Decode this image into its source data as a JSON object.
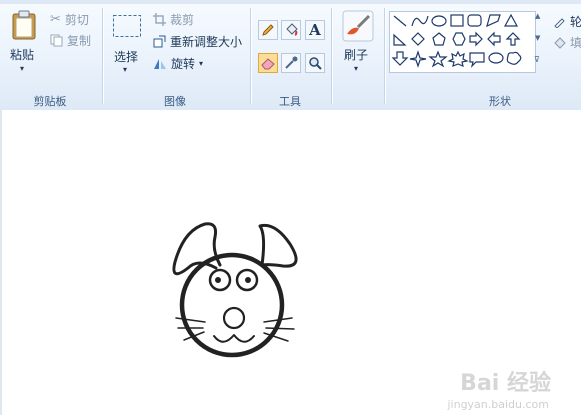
{
  "clipboard": {
    "paste": "粘贴",
    "cut": "剪切",
    "copy": "复制",
    "group": "剪贴板"
  },
  "image": {
    "select": "选择",
    "crop": "裁剪",
    "resize": "重新调整大小",
    "rotate": "旋转",
    "group": "图像"
  },
  "tools": {
    "group": "工具",
    "items": [
      "pencil-icon",
      "fill-icon",
      "text-icon",
      "eraser-icon",
      "color-picker-icon",
      "magnifier-icon"
    ],
    "active": "eraser-icon"
  },
  "brush": {
    "label": "刷子"
  },
  "shapes": {
    "group": "形状",
    "right_top": "轮",
    "right_bottom": "填"
  },
  "watermark": {
    "main": "Bai 经验",
    "sub": "jingyan.baidu.com"
  },
  "colors": {
    "accent": "#fbdc98",
    "ribbon": "#eaf2fb",
    "drawing": "#222222"
  }
}
